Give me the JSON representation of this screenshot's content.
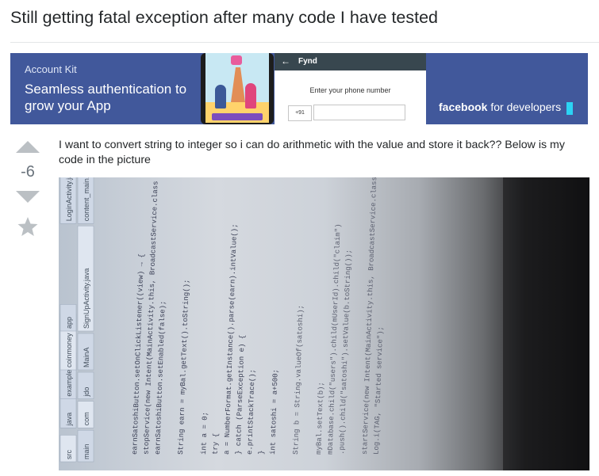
{
  "question": {
    "title": "Still getting fatal exception after many code I have tested",
    "body": "I want to convert string to integer so i can do arithmetic with the value and store it back?? Below is my code in the picture",
    "vote_count": "-6"
  },
  "ad": {
    "product": "Account Kit",
    "headline": "Seamless authentication to grow your App",
    "app_name": "Fynd",
    "phone_prompt": "Enter your phone number",
    "country_code": "+91",
    "brand": "facebook",
    "brand_sub": "for developers",
    "colors": {
      "background": "#41589b",
      "cursor": "#2bd3f4"
    }
  },
  "photo": {
    "ide_tabs": [
      "src",
      "main",
      "java",
      "com",
      "example",
      "jdo",
      "coinmoney",
      "MainA",
      "app",
      "SignUpActivity.java",
      "LoginActivity.java",
      "content_main.xml",
      "app"
    ],
    "code_lines": [
      "earnSatoshiButton.setOnClickListener((view) → {",
      "stopService(new Intent(MainActivity.this, BroadcastService.class",
      "earnSatoshiButton.setEnabled(false);",
      "",
      "String earn = myBal.getText().toString();",
      "",
      "int a = 0;",
      "try {",
      "a = NumberFormat.getInstance().parse(earn).intValue();",
      "} catch (ParseException e) {",
      "e.printStackTrace();",
      "}",
      "int satoshi = a+500;",
      "",
      "String b = String.valueOf(satoshi);",
      "",
      "myBal.setText(b);",
      "mDatabase.child(\"users\").child(mUserId).child(\"claim\")",
      ".push().child(\"satoshi\").setValue(b.toString());",
      "",
      "startService(new Intent(MainActivity.this, BroadcastService.class));",
      "Log.i(TAG, \"Started service\");"
    ]
  }
}
